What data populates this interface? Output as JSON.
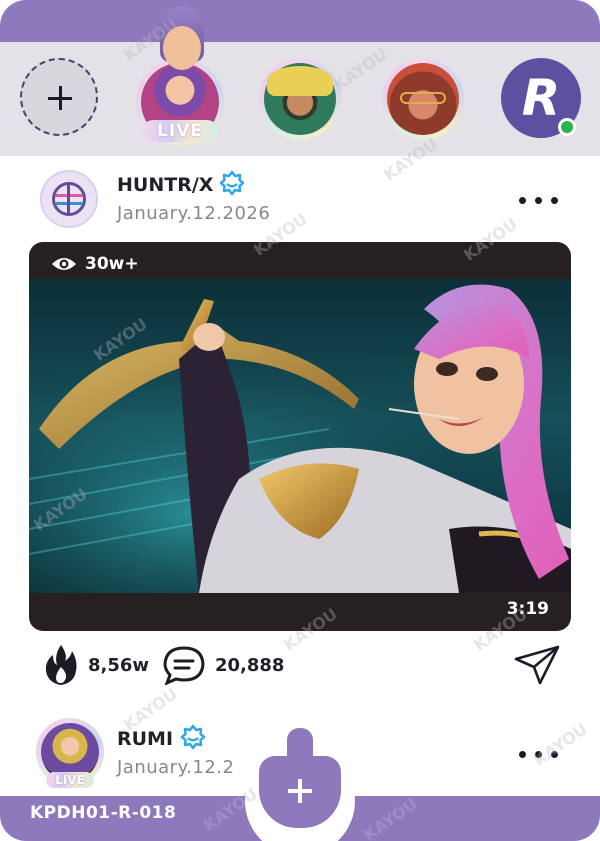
{
  "stories": {
    "add_icon": "plus-icon",
    "live_label": "LIVE"
  },
  "post": {
    "username": "HUNTR/X",
    "date": "January.12.2026",
    "views": "30w+",
    "duration": "3:19",
    "likes": "8,56w",
    "comments": "20,888",
    "icons": {
      "verify": "verified-badge-icon",
      "views": "eye-icon",
      "likes": "fire-icon",
      "comments": "comment-icon",
      "share": "send-icon",
      "more": "more-icon"
    }
  },
  "post2": {
    "username": "RUMI",
    "date": "January.12.2",
    "live_label": "LIVE"
  },
  "footer": {
    "card_code": "KPDH01-R-018"
  },
  "watermark": "KAYOU",
  "colors": {
    "brand": "#8e79bd",
    "online": "#27b44d",
    "verify": "#2ea7e8"
  }
}
